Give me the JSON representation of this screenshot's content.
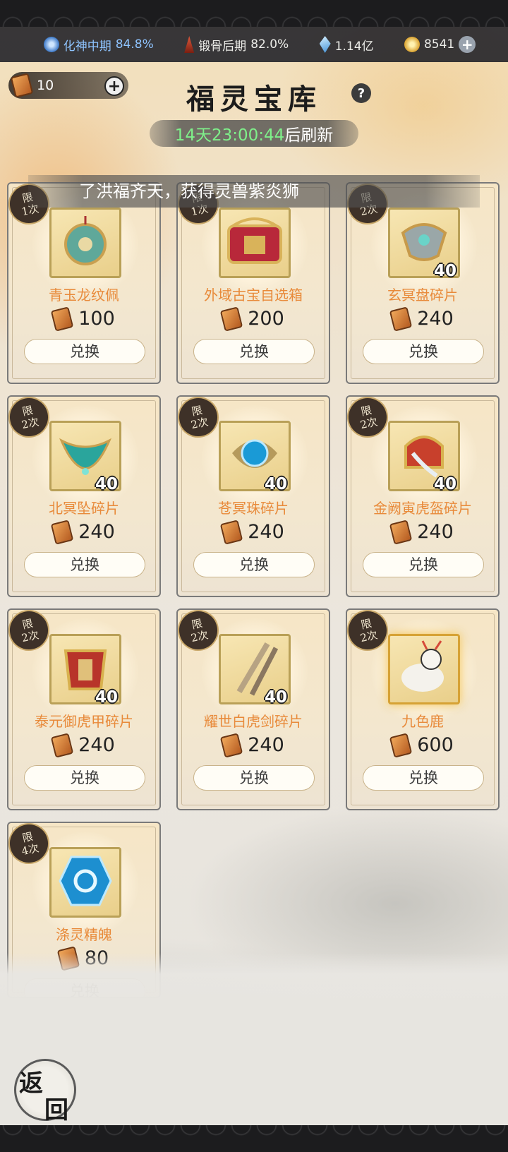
{
  "status_bar": {
    "realm_name": "化神中期",
    "realm_pct": "84.8%",
    "body_name": "锻骨后期",
    "body_pct": "82.0%",
    "spirit_stones": "1.14亿",
    "gold": "8541"
  },
  "tickets": {
    "count": "10"
  },
  "header": {
    "title": "福灵宝库",
    "help": "?",
    "refresh_time": "14天23:00:44",
    "refresh_suffix": "后刷新"
  },
  "marquee": {
    "text": "了洪福齐天，获得灵兽紫炎狮"
  },
  "items": [
    {
      "name": "青玉龙纹佩",
      "price": "100",
      "limit_1": "限",
      "limit_2": "1次",
      "qty": "",
      "redeem": "兑换",
      "icon": "jade-pendant-icon"
    },
    {
      "name": "外域古宝自选箱",
      "price": "200",
      "limit_1": "限",
      "limit_2": "1次",
      "qty": "",
      "redeem": "兑换",
      "icon": "treasure-chest-icon"
    },
    {
      "name": "玄冥盘碎片",
      "price": "240",
      "limit_1": "限",
      "limit_2": "2次",
      "qty": "40",
      "redeem": "兑换",
      "icon": "mask-fragment-icon"
    },
    {
      "name": "北冥坠碎片",
      "price": "240",
      "limit_1": "限",
      "limit_2": "2次",
      "qty": "40",
      "redeem": "兑换",
      "icon": "pendant-fragment-icon"
    },
    {
      "name": "苍冥珠碎片",
      "price": "240",
      "limit_1": "限",
      "limit_2": "2次",
      "qty": "40",
      "redeem": "兑换",
      "icon": "orb-fragment-icon"
    },
    {
      "name": "金阙寅虎盔碎片",
      "price": "240",
      "limit_1": "限",
      "limit_2": "2次",
      "qty": "40",
      "redeem": "兑换",
      "icon": "helmet-fragment-icon"
    },
    {
      "name": "泰元御虎甲碎片",
      "price": "240",
      "limit_1": "限",
      "limit_2": "2次",
      "qty": "40",
      "redeem": "兑换",
      "icon": "armor-fragment-icon"
    },
    {
      "name": "耀世白虎剑碎片",
      "price": "240",
      "limit_1": "限",
      "limit_2": "2次",
      "qty": "40",
      "redeem": "兑换",
      "icon": "sword-fragment-icon"
    },
    {
      "name": "九色鹿",
      "price": "600",
      "limit_1": "限",
      "limit_2": "2次",
      "qty": "",
      "redeem": "兑换",
      "icon": "deer-icon"
    },
    {
      "name": "涤灵精魄",
      "price": "80",
      "limit_1": "限",
      "limit_2": "4次",
      "qty": "",
      "redeem": "兑换",
      "icon": "spirit-crystal-icon"
    }
  ],
  "back_button": {
    "char_1": "返",
    "char_2": "回"
  },
  "colors": {
    "item_name": "#e88a3a",
    "timer": "#7ff08a",
    "accent_gold": "#d6a235"
  }
}
